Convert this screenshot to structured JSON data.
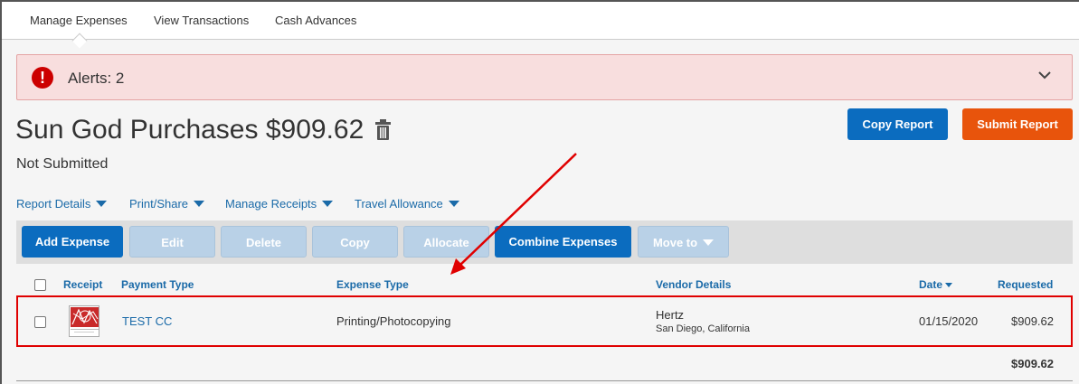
{
  "tabs": [
    {
      "label": "Manage Expenses",
      "active": true
    },
    {
      "label": "View Transactions",
      "active": false
    },
    {
      "label": "Cash Advances",
      "active": false
    }
  ],
  "alert": {
    "text": "Alerts: 2",
    "icon": "exclamation-icon",
    "color": "#cc0000"
  },
  "report": {
    "title": "Sun God Purchases $909.62",
    "status": "Not Submitted",
    "copy_label": "Copy Report",
    "submit_label": "Submit Report"
  },
  "menus": [
    "Report Details",
    "Print/Share",
    "Manage Receipts",
    "Travel Allowance"
  ],
  "toolbar": {
    "add": "Add Expense",
    "edit": "Edit",
    "delete": "Delete",
    "copy": "Copy",
    "allocate": "Allocate",
    "combine": "Combine Expenses",
    "move": "Move to"
  },
  "table": {
    "headers": {
      "receipt": "Receipt",
      "payment_type": "Payment Type",
      "expense_type": "Expense Type",
      "vendor": "Vendor Details",
      "date": "Date",
      "requested": "Requested"
    },
    "rows": [
      {
        "payment_type": "TEST CC",
        "expense_type": "Printing/Photocopying",
        "vendor_name": "Hertz",
        "vendor_location": "San Diego, California",
        "date": "01/15/2020",
        "amount": "$909.62"
      }
    ],
    "total": "$909.62"
  },
  "colors": {
    "primary": "#0b6cbf",
    "submit": "#e8540c",
    "alert_bg": "#f8dede",
    "highlight": "#e00000"
  }
}
